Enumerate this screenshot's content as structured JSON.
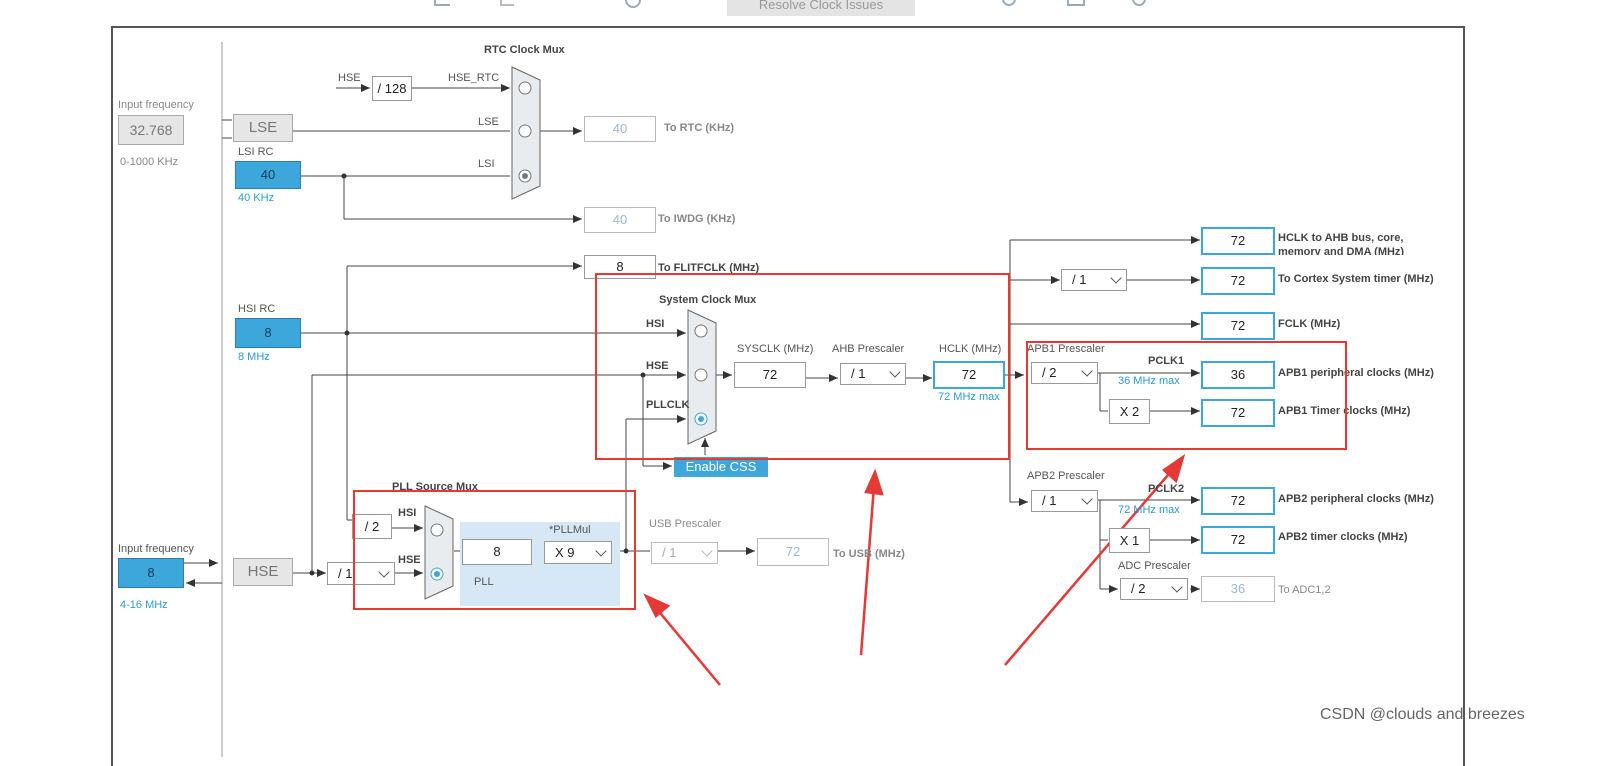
{
  "toolbar": {
    "resolve_label": "Resolve Clock Issues"
  },
  "rtc": {
    "mux_title": "RTC Clock Mux",
    "hse_label": "HSE",
    "div128": "/ 128",
    "hse_rtc": "HSE_RTC",
    "lse_in": "LSE",
    "lsi_in": "LSI",
    "rtc_out": "40",
    "rtc_out_label": "To RTC (KHz)"
  },
  "lse": {
    "input_label": "Input frequency",
    "value": "32.768",
    "range": "0-1000 KHz",
    "name": "LSE"
  },
  "lsi": {
    "name": "LSI RC",
    "value": "40",
    "unit": "40 KHz",
    "iwdg_out": "40",
    "iwdg_label": "To IWDG (KHz)"
  },
  "flitf": {
    "value": "8",
    "label": "To FLITFCLK (MHz)"
  },
  "hsi": {
    "name": "HSI RC",
    "value": "8",
    "unit": "8 MHz"
  },
  "sysmux": {
    "title": "System Clock Mux",
    "in_hsi": "HSI",
    "in_hse": "HSE",
    "in_pll": "PLLCLK",
    "sysclk_label": "SYSCLK (MHz)",
    "sysclk": "72",
    "ahb_label": "AHB Prescaler",
    "ahb": "/ 1",
    "hclk_label": "HCLK (MHz)",
    "hclk": "72",
    "hclk_max": "72 MHz max",
    "css_label": "Enable CSS"
  },
  "outputs": {
    "ahb": {
      "value": "72",
      "label": "HCLK to AHB bus, core, memory and DMA (MHz)"
    },
    "cortex": {
      "div": "/ 1",
      "value": "72",
      "label": "To Cortex System timer (MHz)"
    },
    "fclk": {
      "value": "72",
      "label": "FCLK (MHz)"
    }
  },
  "apb1": {
    "title": "APB1 Prescaler",
    "div": "/ 2",
    "pclk": "PCLK1",
    "max": "36 MHz max",
    "periph": "36",
    "periph_label": "APB1 peripheral clocks (MHz)",
    "x": "X 2",
    "timer": "72",
    "timer_label": "APB1 Timer clocks (MHz)"
  },
  "apb2": {
    "title": "APB2 Prescaler",
    "div": "/ 1",
    "pclk": "PCLK2",
    "max": "72 MHz max",
    "periph": "72",
    "periph_label": "APB2 peripheral clocks (MHz)",
    "x": "X 1",
    "timer": "72",
    "timer_label": "APB2 timer clocks (MHz)"
  },
  "adc": {
    "title": "ADC Prescaler",
    "div": "/ 2",
    "value": "36",
    "label": "To ADC1,2"
  },
  "pll": {
    "mux_title": "PLL Source Mux",
    "div2": "/ 2",
    "in_hsi": "HSI",
    "in_hse": "HSE",
    "mul_label": "*PLLMul",
    "value": "8",
    "mul": "X 9",
    "name": "PLL"
  },
  "usb": {
    "title": "USB Prescaler",
    "div": "/ 1",
    "value": "72",
    "label": "To USB (MHz)"
  },
  "hse": {
    "input_label": "Input frequency",
    "value": "8",
    "range": "4-16 MHz",
    "name": "HSE",
    "div": "/ 1"
  },
  "watermark": "CSDN @clouds and breezes",
  "colors": {
    "source_blue": "#3da6db",
    "highlight_red": "#e53935"
  }
}
